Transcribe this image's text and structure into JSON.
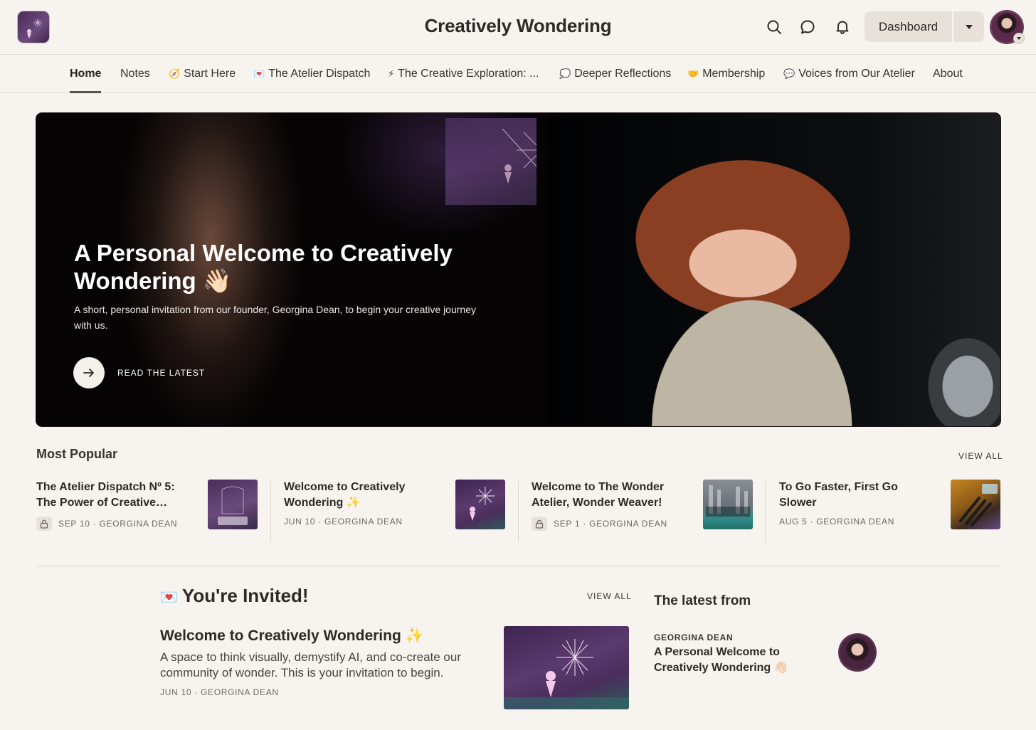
{
  "header": {
    "title": "Creatively Wondering",
    "dashboard_label": "Dashboard",
    "icons": [
      "search-icon",
      "chat-icon",
      "bell-icon"
    ]
  },
  "nav": {
    "items": [
      {
        "label": "Home",
        "emoji": ""
      },
      {
        "label": "Notes",
        "emoji": ""
      },
      {
        "label": "Start Here",
        "emoji": "🧭"
      },
      {
        "label": "The Atelier Dispatch",
        "emoji": "💌"
      },
      {
        "label": "The Creative Exploration: ...",
        "emoji": "⚡"
      },
      {
        "label": "Deeper Reflections",
        "emoji": "💭"
      },
      {
        "label": "Membership",
        "emoji": "🤝"
      },
      {
        "label": "Voices from Our Atelier",
        "emoji": "💬"
      },
      {
        "label": "About",
        "emoji": ""
      }
    ]
  },
  "hero": {
    "title": "A Personal Welcome to Creatively Wondering 👋🏻",
    "description": "A short, personal invitation from our founder, Georgina Dean, to begin your creative journey with us.",
    "cta_label": "READ THE LATEST"
  },
  "most_popular": {
    "heading": "Most Popular",
    "view_all": "VIEW ALL",
    "posts": [
      {
        "title": "The Atelier Dispatch Nº 5: The Power of Creative…",
        "meta": "SEP 10 · GEORGINA DEAN",
        "locked": true
      },
      {
        "title": "Welcome to Creatively Wondering ✨",
        "meta": "JUN 10 · GEORGINA DEAN",
        "locked": false
      },
      {
        "title": "Welcome to The Wonder Atelier, Wonder Weaver!",
        "meta": "SEP 1 · GEORGINA DEAN",
        "locked": true
      },
      {
        "title": "To Go Faster, First Go Slower",
        "meta": "AUG 5 · GEORGINA DEAN",
        "locked": false
      }
    ]
  },
  "invited": {
    "heading": "You're Invited!",
    "emoji": "💌",
    "view_all": "VIEW ALL",
    "post_title": "Welcome to Creatively Wondering ✨",
    "post_desc": "A space to think visually, demystify AI, and co-create our community of wonder. This is your invitation to begin.",
    "post_meta": "JUN 10 · GEORGINA DEAN"
  },
  "latest": {
    "heading": "The latest from",
    "author": "GEORGINA DEAN",
    "title": "A Personal Welcome to Creatively Wondering 👋🏻"
  }
}
